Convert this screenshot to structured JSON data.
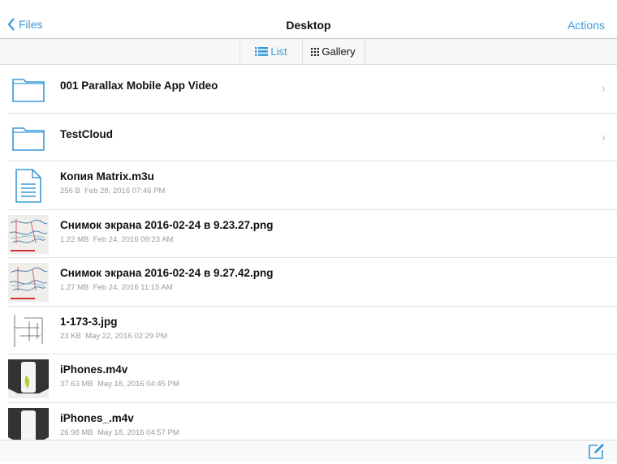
{
  "nav": {
    "back_label": "Files",
    "title": "Desktop",
    "actions_label": "Actions"
  },
  "segments": {
    "list": "List",
    "gallery": "Gallery",
    "selected": "List"
  },
  "accent": "#3a9ad9",
  "items": [
    {
      "type": "folder",
      "name": "001 Parallax Mobile App Video"
    },
    {
      "type": "folder",
      "name": "TestCloud"
    },
    {
      "type": "document",
      "name": "Копия Matrix.m3u",
      "size": "256 B",
      "date": "Feb 28, 2016 07:46 PM"
    },
    {
      "type": "map-image",
      "name": "Снимок экрана 2016-02-24 в 9.23.27.png",
      "size": "1.22 MB",
      "date": "Feb 24, 2016 09:23 AM"
    },
    {
      "type": "map-image",
      "name": "Снимок экрана 2016-02-24 в 9.27.42.png",
      "size": "1.27 MB",
      "date": "Feb 24, 2016 11:15 AM"
    },
    {
      "type": "schematic-image",
      "name": "1-173-3.jpg",
      "size": "23 KB",
      "date": "May 22, 2016 02:29 PM"
    },
    {
      "type": "video",
      "name": "iPhones.m4v",
      "size": "37.63 MB",
      "date": "May 18, 2016 04:45 PM"
    },
    {
      "type": "video",
      "name": "iPhones_.m4v",
      "size": "26.98 MB",
      "date": "May 18, 2016 04:57 PM"
    }
  ]
}
